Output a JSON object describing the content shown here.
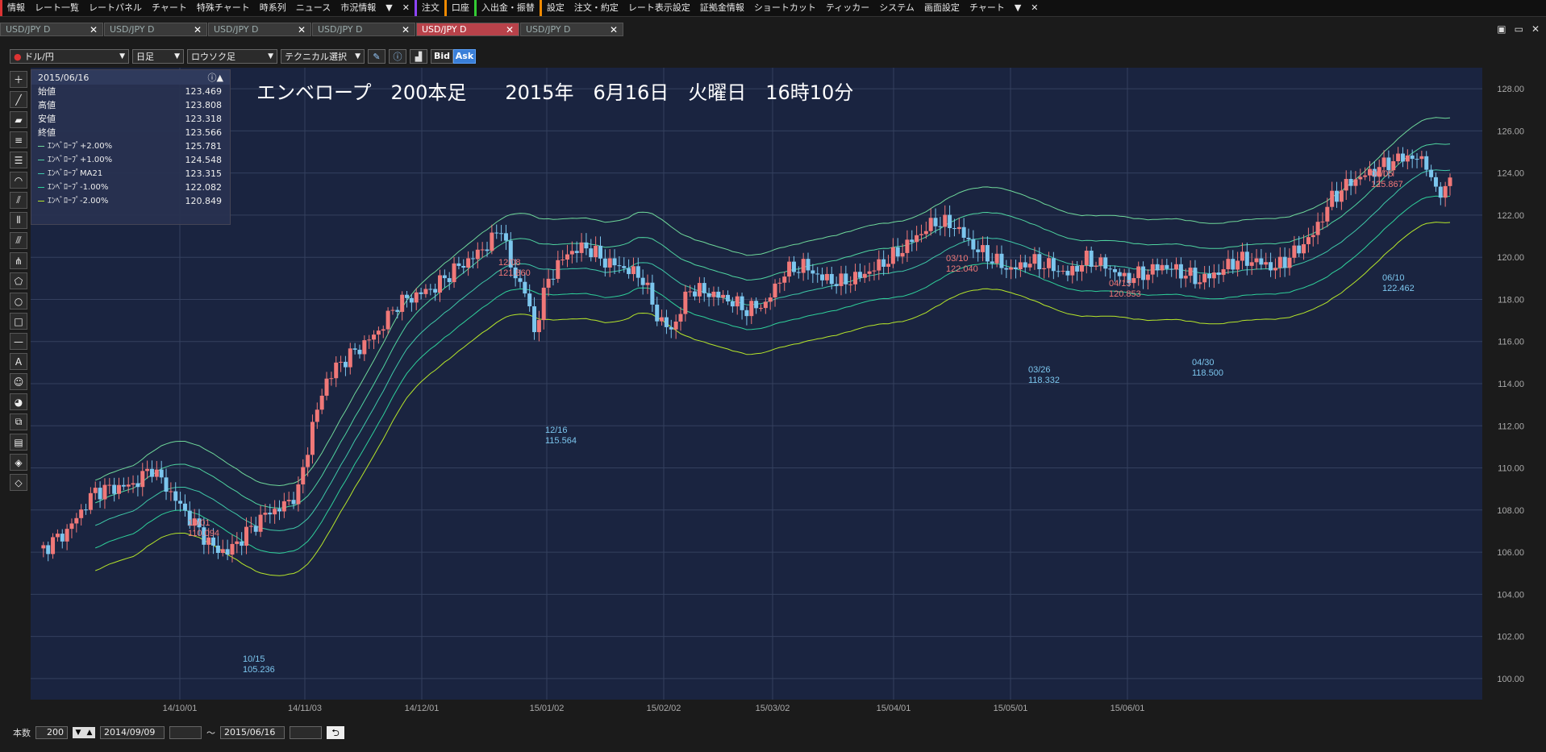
{
  "menu": {
    "items": [
      {
        "label": "情報",
        "mark": "red"
      },
      {
        "label": "レート一覧"
      },
      {
        "label": "レートパネル"
      },
      {
        "label": "チャート"
      },
      {
        "label": "特殊チャート"
      },
      {
        "label": "時系列"
      },
      {
        "label": "ニュース"
      },
      {
        "label": "市況情報"
      },
      {
        "label": "▼"
      },
      {
        "label": "✕"
      },
      {
        "label": "注文",
        "mark": "purple"
      },
      {
        "label": "口座",
        "mark": "orange"
      },
      {
        "label": "入出金・振替",
        "mark": "green"
      },
      {
        "label": "設定",
        "mark": "orange"
      },
      {
        "label": "注文・約定"
      },
      {
        "label": "レート表示設定"
      },
      {
        "label": "証拠金情報"
      },
      {
        "label": "ショートカット"
      },
      {
        "label": "ティッカー"
      },
      {
        "label": "システム"
      },
      {
        "label": "画面設定"
      },
      {
        "label": "チャート"
      },
      {
        "label": "▼"
      },
      {
        "label": "✕"
      }
    ]
  },
  "tabs": [
    {
      "label": "USD/JPY D",
      "active": false
    },
    {
      "label": "USD/JPY D",
      "active": false
    },
    {
      "label": "USD/JPY D",
      "active": false
    },
    {
      "label": "USD/JPY D",
      "active": false
    },
    {
      "label": "USD/JPY D",
      "active": true
    },
    {
      "label": "USD/JPY D",
      "active": false
    }
  ],
  "toolbar": {
    "pair": "ドル/円",
    "period": "日足",
    "chart_type": "ロウソク足",
    "technical": "テクニカル選択",
    "bid": "Bid",
    "ask": "Ask"
  },
  "info": {
    "date": "2015/06/16",
    "rows": [
      {
        "k": "始値",
        "v": "123.469"
      },
      {
        "k": "高値",
        "v": "123.808"
      },
      {
        "k": "安値",
        "v": "123.318"
      },
      {
        "k": "終値",
        "v": "123.566"
      }
    ],
    "indicators": [
      {
        "k": "ｴﾝﾍﾞﾛｰﾌﾟ+2.00%",
        "v": "125.781",
        "color": "#6fd89a"
      },
      {
        "k": "ｴﾝﾍﾞﾛｰﾌﾟ+1.00%",
        "v": "124.548",
        "color": "#4fd4a0"
      },
      {
        "k": "ｴﾝﾍﾞﾛｰﾌﾟMA21",
        "v": "123.315",
        "color": "#3fc8a8"
      },
      {
        "k": "ｴﾝﾍﾞﾛｰﾌﾟ-1.00%",
        "v": "122.082",
        "color": "#2fd09a"
      },
      {
        "k": "ｴﾝﾍﾞﾛｰﾌﾟ-2.00%",
        "v": "120.849",
        "color": "#b6e62a"
      }
    ]
  },
  "chart_title": "エンベロープ　200本足　　2015年　6月16日　火曜日　16時10分",
  "status": {
    "count_label": "本数",
    "count": "200",
    "from": "2014/09/09",
    "tilde": "～",
    "to": "2015/06/16"
  },
  "chart_data": {
    "type": "candlestick",
    "ylim": [
      99,
      129
    ],
    "yticks": [
      "100.00",
      "102.00",
      "104.00",
      "106.00",
      "108.00",
      "110.00",
      "112.00",
      "114.00",
      "116.00",
      "118.00",
      "120.00",
      "122.00",
      "124.00",
      "126.00",
      "128.00"
    ],
    "xticks": [
      {
        "label": "14/10/01",
        "x": 185
      },
      {
        "label": "14/11/03",
        "x": 340
      },
      {
        "label": "14/12/01",
        "x": 485
      },
      {
        "label": "15/01/02",
        "x": 640
      },
      {
        "label": "15/02/02",
        "x": 785
      },
      {
        "label": "15/03/02",
        "x": 920
      },
      {
        "label": "15/04/01",
        "x": 1070
      },
      {
        "label": "15/05/01",
        "x": 1215
      },
      {
        "label": "15/06/01",
        "x": 1360
      }
    ],
    "annotations": [
      {
        "date": "10/01",
        "value": "110.094",
        "type": "high"
      },
      {
        "date": "10/15",
        "value": "105.236",
        "type": "low"
      },
      {
        "date": "12/08",
        "value": "121.860",
        "type": "high"
      },
      {
        "date": "12/16",
        "value": "115.564",
        "type": "low"
      },
      {
        "date": "03/10",
        "value": "122.040",
        "type": "high"
      },
      {
        "date": "03/26",
        "value": "118.332",
        "type": "low"
      },
      {
        "date": "04/13",
        "value": "120.853",
        "type": "high"
      },
      {
        "date": "04/30",
        "value": "118.500",
        "type": "low"
      },
      {
        "date": "06/05",
        "value": "125.867",
        "type": "high"
      },
      {
        "date": "06/10",
        "value": "122.462",
        "type": "low"
      }
    ],
    "close_anchors": [
      [
        0,
        106.0
      ],
      [
        6,
        107.0
      ],
      [
        12,
        108.9
      ],
      [
        20,
        109.2
      ],
      [
        24,
        110.0
      ],
      [
        28,
        108.8
      ],
      [
        32,
        107.6
      ],
      [
        37,
        106.2
      ],
      [
        40,
        106.0
      ],
      [
        44,
        106.9
      ],
      [
        48,
        107.8
      ],
      [
        52,
        108.2
      ],
      [
        55,
        108.9
      ],
      [
        58,
        112.0
      ],
      [
        61,
        114.2
      ],
      [
        64,
        115.0
      ],
      [
        68,
        115.7
      ],
      [
        72,
        116.5
      ],
      [
        76,
        117.8
      ],
      [
        80,
        118.2
      ],
      [
        84,
        118.6
      ],
      [
        88,
        119.4
      ],
      [
        92,
        120.0
      ],
      [
        96,
        120.8
      ],
      [
        98,
        121.5
      ],
      [
        100,
        119.5
      ],
      [
        103,
        118.4
      ],
      [
        105,
        116.5
      ],
      [
        108,
        119.0
      ],
      [
        112,
        120.2
      ],
      [
        116,
        120.5
      ],
      [
        120,
        119.8
      ],
      [
        124,
        119.5
      ],
      [
        128,
        119.0
      ],
      [
        131,
        117.2
      ],
      [
        134,
        116.5
      ],
      [
        138,
        118.5
      ],
      [
        142,
        118.3
      ],
      [
        146,
        118.0
      ],
      [
        150,
        117.5
      ],
      [
        154,
        117.8
      ],
      [
        158,
        119.3
      ],
      [
        162,
        119.6
      ],
      [
        166,
        119.0
      ],
      [
        170,
        118.8
      ],
      [
        174,
        119.1
      ],
      [
        178,
        119.6
      ],
      [
        182,
        120.2
      ],
      [
        186,
        121.0
      ],
      [
        190,
        121.7
      ],
      [
        194,
        121.5
      ],
      [
        198,
        120.5
      ],
      [
        202,
        119.9
      ],
      [
        206,
        119.4
      ],
      [
        210,
        119.8
      ],
      [
        214,
        119.6
      ],
      [
        218,
        119.2
      ],
      [
        222,
        119.9
      ],
      [
        226,
        119.6
      ],
      [
        230,
        119.0
      ],
      [
        234,
        119.2
      ],
      [
        238,
        119.6
      ],
      [
        242,
        119.3
      ],
      [
        246,
        118.9
      ],
      [
        250,
        119.3
      ],
      [
        254,
        119.9
      ],
      [
        258,
        119.8
      ],
      [
        262,
        119.5
      ],
      [
        266,
        120.2
      ],
      [
        270,
        121.1
      ],
      [
        274,
        122.8
      ],
      [
        278,
        123.6
      ],
      [
        282,
        124.0
      ],
      [
        286,
        124.5
      ],
      [
        290,
        124.8
      ],
      [
        294,
        124.5
      ],
      [
        296,
        123.0
      ],
      [
        299,
        123.566
      ]
    ]
  }
}
